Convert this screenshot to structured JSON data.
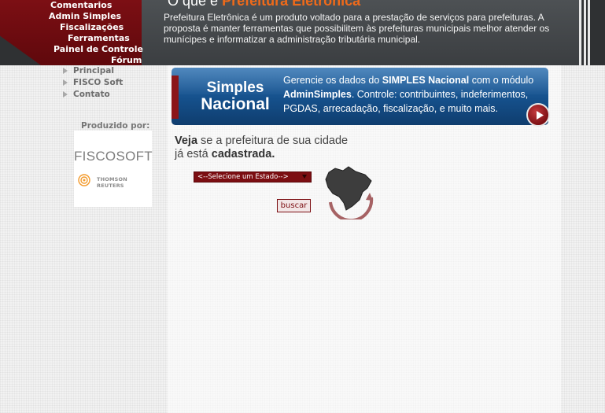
{
  "header": {
    "title_prefix": "O que é",
    "title_highlight": "Prefeitura Eletrônica",
    "description": "Prefeitura Eletrônica é um produto voltado para a prestação de serviços para prefeituras. A proposta é manter ferramentas que possibilitem às prefeituras municipais melhor atender os munícipes e informatizar a administração tributária municipal.",
    "menu": [
      "Comentarios",
      "Admin Simples",
      "Fiscalizações",
      "Ferramentas",
      "Painel de Controle",
      "Fórum"
    ]
  },
  "left_menu": {
    "items": [
      "Principal",
      "FISCO Soft",
      "Contato"
    ],
    "produced_by_label": "Produzido por:",
    "sponsor_logo_text": "FISCOSOFT",
    "sponsor_partner_text": "THOMSON REUTERS"
  },
  "banner": {
    "logo_line1": "Simples",
    "logo_line2": "Nacional",
    "text_part1": "Gerencie os dados do ",
    "text_bold1": "SIMPLES Nacional",
    "text_part2": " com o módulo ",
    "text_bold2": "AdminSimples",
    "text_part3": ". Controle: contribuintes, indeferimentos, PGDAS, arrecadação, fiscalização, e muito mais."
  },
  "city_check": {
    "line1_bold": "Veja",
    "line1_rest": " se a prefeitura de sua cidade",
    "line2_rest": "já está ",
    "line2_bold": "cadastrada.",
    "select_value": "<--Selecione um Estado-->",
    "search_button_label": "buscar"
  },
  "colors": {
    "brand_red": "#7c0e12",
    "header_dark": "#2f3133",
    "highlight_orange": "#ef6a1a",
    "banner_blue": "#15508b"
  },
  "icons": [
    "arrow-bullet-icon",
    "play-arrow-icon",
    "brazil-map-icon",
    "thomson-reuters-icon"
  ]
}
